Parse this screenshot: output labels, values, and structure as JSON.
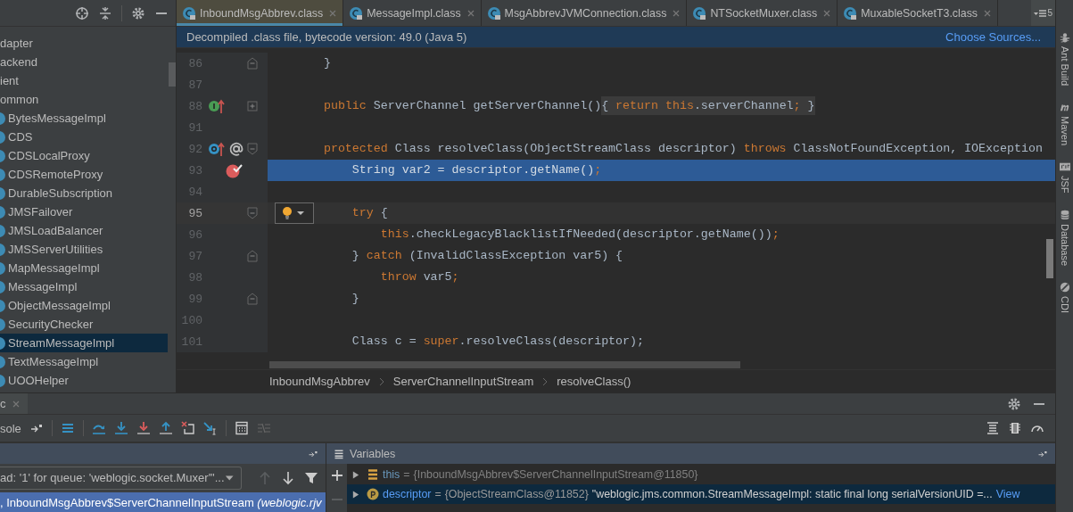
{
  "project_panel": {
    "items": [
      {
        "label": "dapter",
        "kind": "package",
        "selected": false
      },
      {
        "label": "ackend",
        "kind": "package",
        "selected": false
      },
      {
        "label": "ient",
        "kind": "package",
        "selected": false
      },
      {
        "label": "ommon",
        "kind": "package",
        "selected": false
      },
      {
        "label": "BytesMessageImpl",
        "kind": "class",
        "selected": false
      },
      {
        "label": "CDS",
        "kind": "class",
        "selected": false
      },
      {
        "label": "CDSLocalProxy",
        "kind": "class",
        "selected": false
      },
      {
        "label": "CDSRemoteProxy",
        "kind": "class",
        "selected": false
      },
      {
        "label": "DurableSubscription",
        "kind": "class",
        "selected": false
      },
      {
        "label": "JMSFailover",
        "kind": "class",
        "selected": false
      },
      {
        "label": "JMSLoadBalancer",
        "kind": "class",
        "selected": false
      },
      {
        "label": "JMSServerUtilities",
        "kind": "class",
        "selected": false
      },
      {
        "label": "MapMessageImpl",
        "kind": "class",
        "selected": false
      },
      {
        "label": "MessageImpl",
        "kind": "class",
        "selected": false
      },
      {
        "label": "ObjectMessageImpl",
        "kind": "class",
        "selected": false
      },
      {
        "label": "SecurityChecker",
        "kind": "class",
        "selected": false
      },
      {
        "label": "StreamMessageImpl",
        "kind": "class",
        "selected": true
      },
      {
        "label": "TextMessageImpl",
        "kind": "class",
        "selected": false
      },
      {
        "label": "UOOHelper",
        "kind": "class",
        "selected": false
      }
    ]
  },
  "editor_tabs": [
    {
      "label": "InboundMsgAbbrev.class",
      "selected": true
    },
    {
      "label": "MessageImpl.class",
      "selected": false
    },
    {
      "label": "MsgAbbrevJVMConnection.class",
      "selected": false
    },
    {
      "label": "NTSocketMuxer.class",
      "selected": false
    },
    {
      "label": "MuxableSocketT3.class",
      "selected": false
    }
  ],
  "tab_overflow_count": "5",
  "banner": {
    "text": "Decompiled .class file, bytecode version: 49.0 (Java 5)",
    "link": "Choose Sources..."
  },
  "code_lines": [
    {
      "number": "86",
      "gutter": [
        {
          "kind": "fold_end"
        }
      ],
      "execution_point": false,
      "caret_line": false,
      "tokens": [
        {
          "text": "    }",
          "kind": "plain"
        }
      ]
    },
    {
      "number": "87",
      "execution_point": false,
      "caret_line": false
    },
    {
      "number": "88",
      "gutter": [
        {
          "kind": "implements"
        },
        {
          "kind": "fold_collapsed"
        }
      ],
      "execution_point": false,
      "caret_line": false,
      "tokens": [
        {
          "text": "    public",
          "kind": "keyword"
        },
        {
          "text": " ServerChannel getServerChannel()",
          "kind": "plain"
        }
      ],
      "folded_tokens": [
        {
          "text": "{ ",
          "kind": "plain"
        },
        {
          "text": "return ",
          "kind": "keyword"
        },
        {
          "text": "this",
          "kind": "keyword"
        },
        {
          "text": ".serverChannel",
          "kind": "plain"
        },
        {
          "text": ";",
          "kind": "keyword"
        },
        {
          "text": " }",
          "kind": "plain"
        }
      ]
    },
    {
      "number": "91",
      "execution_point": false,
      "caret_line": false
    },
    {
      "number": "92",
      "gutter": [
        {
          "kind": "overrides"
        },
        {
          "kind": "annotation"
        },
        {
          "kind": "fold_start"
        }
      ],
      "execution_point": false,
      "caret_line": false,
      "tokens": [
        {
          "text": "    protected",
          "kind": "keyword"
        },
        {
          "text": " Class resolveClass(ObjectStreamClass descriptor) ",
          "kind": "plain"
        },
        {
          "text": "throws",
          "kind": "keyword"
        },
        {
          "text": " ClassNotFoundException, IOException",
          "kind": "plain"
        }
      ]
    },
    {
      "number": "93",
      "gutter": [
        {
          "kind": "breakpoint"
        }
      ],
      "execution_point": true,
      "caret_line": false,
      "tokens": [
        {
          "text": "        String var2 = descriptor.getName()",
          "kind": "plain"
        },
        {
          "text": ";",
          "kind": "keyword"
        }
      ]
    },
    {
      "number": "94",
      "execution_point": false,
      "caret_line": false
    },
    {
      "number": "95",
      "gutter": [
        {
          "kind": "fold_start"
        }
      ],
      "execution_point": false,
      "caret_line": true,
      "tokens": [
        {
          "text": "        try",
          "kind": "keyword"
        },
        {
          "text": " {",
          "kind": "plain"
        }
      ]
    },
    {
      "number": "96",
      "execution_point": false,
      "caret_line": false,
      "tokens": [
        {
          "text": "            this",
          "kind": "keyword"
        },
        {
          "text": ".checkLegacyBlacklistIfNeeded(descriptor.getName())",
          "kind": "plain"
        },
        {
          "text": ";",
          "kind": "keyword"
        }
      ]
    },
    {
      "number": "97",
      "gutter": [
        {
          "kind": "fold_end"
        }
      ],
      "execution_point": false,
      "caret_line": false,
      "tokens": [
        {
          "text": "        } ",
          "kind": "plain"
        },
        {
          "text": "catch",
          "kind": "keyword"
        },
        {
          "text": " (InvalidClassException var5) {",
          "kind": "plain"
        }
      ]
    },
    {
      "number": "98",
      "execution_point": false,
      "caret_line": false,
      "tokens": [
        {
          "text": "            throw",
          "kind": "keyword"
        },
        {
          "text": " var5",
          "kind": "plain"
        },
        {
          "text": ";",
          "kind": "keyword"
        }
      ]
    },
    {
      "number": "99",
      "gutter": [
        {
          "kind": "fold_end"
        }
      ],
      "execution_point": false,
      "caret_line": false,
      "tokens": [
        {
          "text": "        }",
          "kind": "plain"
        }
      ]
    },
    {
      "number": "100",
      "execution_point": false,
      "caret_line": false
    },
    {
      "number": "101",
      "execution_point": false,
      "caret_line": false,
      "tokens": [
        {
          "text": "        Class c = ",
          "kind": "plain"
        },
        {
          "text": "super",
          "kind": "keyword"
        },
        {
          "text": ".resolveClass(descriptor);",
          "kind": "plain"
        }
      ]
    }
  ],
  "breadcrumbs": [
    "InboundMsgAbbrev",
    "ServerChannelInputStream",
    "resolveClass()"
  ],
  "tool_windows": [
    {
      "label": "Ant Build",
      "kind": "ant"
    },
    {
      "label": "Maven",
      "kind": "maven"
    },
    {
      "label": "JSF",
      "kind": "jsf"
    },
    {
      "label": "Database",
      "kind": "database"
    },
    {
      "label": "CDI",
      "kind": "cdi"
    }
  ],
  "debug_panel": {
    "tab_label": "c",
    "console_tab": "sole",
    "frames": {
      "thread": "ad: '1' for queue: 'weblogic.socket.Muxer'\"...",
      "rows": [
        {
          "text": ", InboundMsgAbbrev$ServerChannelInputStream *(weblogic.rjv*",
          "selected": true
        }
      ]
    },
    "variables": {
      "title": "Variables",
      "rows": [
        {
          "name": "this",
          "kind": "object",
          "separator": "=",
          "value": "{InboundMsgAbbrev$ServerChannelInputStream@11850}",
          "selected": false
        },
        {
          "name": "descriptor",
          "kind": "parameter",
          "separator": "=",
          "value": "{ObjectStreamClass@11852}",
          "string_value": "\"weblogic.jms.common.StreamMessageImpl: static final long serialVersionUID =...",
          "link": "View",
          "selected": true
        }
      ]
    }
  }
}
